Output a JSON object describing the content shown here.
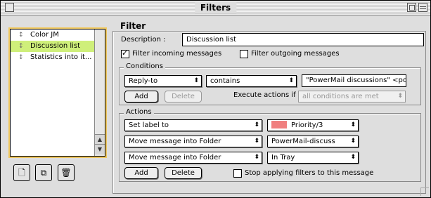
{
  "window": {
    "title": "Filters"
  },
  "filter_list": {
    "items": [
      {
        "label": "Color JM",
        "selected": false
      },
      {
        "label": "Discussion list",
        "selected": true
      },
      {
        "label": "Statistics into it...",
        "selected": false
      }
    ]
  },
  "toolbar": {
    "icons": [
      "new-filter-icon",
      "duplicate-filter-icon",
      "delete-filter-icon"
    ]
  },
  "filter": {
    "heading": "Filter",
    "description_label": "Description :",
    "description_value": "Discussion list",
    "incoming_label": "Filter incoming messages",
    "incoming_checked": true,
    "outgoing_label": "Filter outgoing messages",
    "outgoing_checked": false
  },
  "conditions": {
    "title": "Conditions",
    "field": "Reply-to",
    "operator": "contains",
    "value": "\"PowerMail discussions\" <po",
    "add_label": "Add",
    "delete_label": "Delete",
    "execute_label": "Execute actions if",
    "execute_value": "all conditions are met"
  },
  "actions": {
    "title": "Actions",
    "rows": [
      {
        "action": "Set label to",
        "target": "Priority/3",
        "swatch_color": "#f07f7f"
      },
      {
        "action": "Move message into Folder",
        "target": "PowerMail-discuss"
      },
      {
        "action": "Move message into Folder",
        "target": "In Tray"
      }
    ],
    "add_label": "Add",
    "delete_label": "Delete",
    "stop_label": "Stop applying filters to this message",
    "stop_checked": false
  }
}
